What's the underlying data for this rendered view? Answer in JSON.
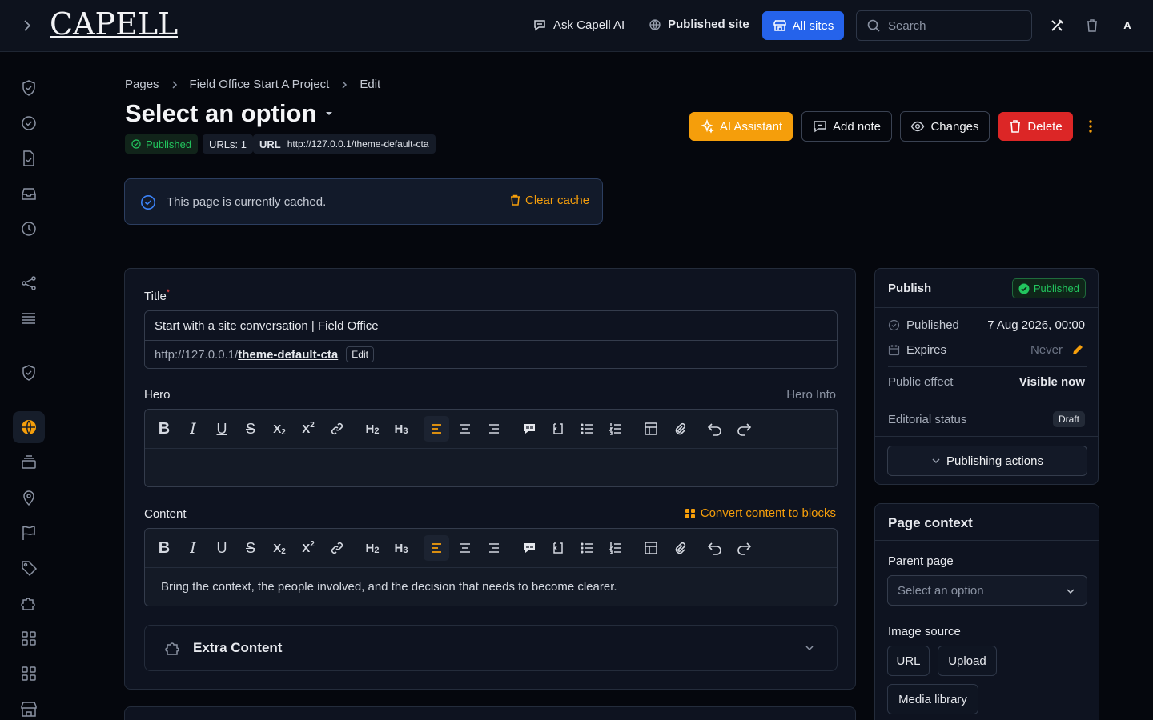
{
  "topbar": {
    "logo_text": "CAPELL",
    "ask_ai": "Ask Capell AI",
    "published_site": "Published site",
    "all_sites": "All sites",
    "search_placeholder": "Search",
    "user_initial": "A"
  },
  "breadcrumb": [
    "Pages",
    "Field Office Start A Project",
    "Edit"
  ],
  "page": {
    "title": "Select an option",
    "status_badge": "Published",
    "urls_count": "URLs: 1",
    "url_label": "URL",
    "url_value": "http://127.0.0.1/theme-default-cta"
  },
  "actions": {
    "ai_assistant": "AI Assistant",
    "add_note": "Add note",
    "changes": "Changes",
    "delete": "Delete"
  },
  "cache_notice": {
    "text": "This page is currently cached.",
    "action": "Clear cache"
  },
  "form": {
    "title_label": "Title",
    "title_value": "Start with a site conversation | Field Office",
    "slug_prefix": "http://127.0.0.1/",
    "slug": "theme-default-cta",
    "slug_edit": "Edit",
    "hero_label": "Hero",
    "hero_info": "Hero Info",
    "content_label": "Content",
    "convert_blocks": "Convert content to blocks",
    "content_value": "Bring the context, the people involved, and the decision that needs to become clearer.",
    "extra_content": "Extra Content"
  },
  "publish": {
    "heading": "Publish",
    "badge": "Published",
    "published_label": "Published",
    "published_value": "7 Aug 2026, 00:00",
    "expires_label": "Expires",
    "expires_value": "Never",
    "public_effect_label": "Public effect",
    "public_effect_value": "Visible now",
    "editorial_label": "Editorial status",
    "editorial_value": "Draft",
    "actions_button": "Publishing actions"
  },
  "context": {
    "heading": "Page context",
    "parent_label": "Parent page",
    "parent_placeholder": "Select an option",
    "image_source_label": "Image source",
    "source_url": "URL",
    "source_upload": "Upload",
    "source_media": "Media library"
  },
  "colors": {
    "accent": "#f59e0b",
    "primary_blue": "#2563eb",
    "danger": "#dc2626",
    "success": "#22c55e"
  }
}
